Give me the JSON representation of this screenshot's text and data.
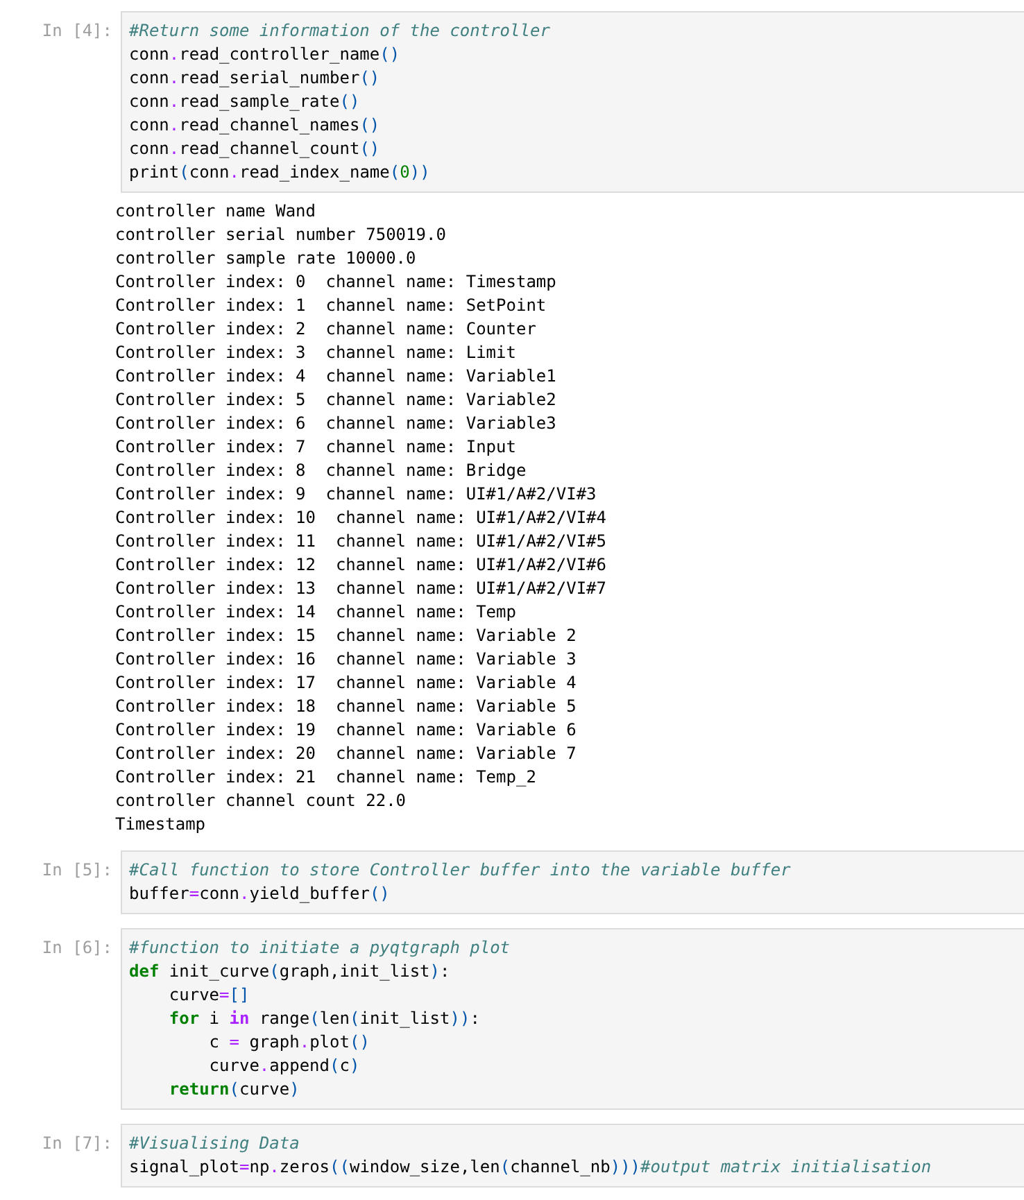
{
  "cells": [
    {
      "prompt": "In [4]:",
      "code": [
        [
          {
            "kind": "comment",
            "text": "#Return some information of the controller"
          }
        ],
        [
          {
            "kind": "name",
            "text": "conn"
          },
          {
            "kind": "op",
            "text": "."
          },
          {
            "kind": "name",
            "text": "read_controller_name"
          },
          {
            "kind": "paren",
            "text": "()"
          }
        ],
        [
          {
            "kind": "name",
            "text": "conn"
          },
          {
            "kind": "op",
            "text": "."
          },
          {
            "kind": "name",
            "text": "read_serial_number"
          },
          {
            "kind": "paren",
            "text": "()"
          }
        ],
        [
          {
            "kind": "name",
            "text": "conn"
          },
          {
            "kind": "op",
            "text": "."
          },
          {
            "kind": "name",
            "text": "read_sample_rate"
          },
          {
            "kind": "paren",
            "text": "()"
          }
        ],
        [
          {
            "kind": "name",
            "text": "conn"
          },
          {
            "kind": "op",
            "text": "."
          },
          {
            "kind": "name",
            "text": "read_channel_names"
          },
          {
            "kind": "paren",
            "text": "()"
          }
        ],
        [
          {
            "kind": "name",
            "text": "conn"
          },
          {
            "kind": "op",
            "text": "."
          },
          {
            "kind": "name",
            "text": "read_channel_count"
          },
          {
            "kind": "paren",
            "text": "()"
          }
        ],
        [
          {
            "kind": "name",
            "text": "print"
          },
          {
            "kind": "paren",
            "text": "("
          },
          {
            "kind": "name",
            "text": "conn"
          },
          {
            "kind": "op",
            "text": "."
          },
          {
            "kind": "name",
            "text": "read_index_name"
          },
          {
            "kind": "paren",
            "text": "("
          },
          {
            "kind": "number",
            "text": "0"
          },
          {
            "kind": "paren",
            "text": "))"
          }
        ]
      ],
      "output": [
        "controller name Wand",
        "controller serial number 750019.0",
        "controller sample rate 10000.0",
        "Controller index: 0  channel name: Timestamp",
        "Controller index: 1  channel name: SetPoint",
        "Controller index: 2  channel name: Counter",
        "Controller index: 3  channel name: Limit",
        "Controller index: 4  channel name: Variable1",
        "Controller index: 5  channel name: Variable2",
        "Controller index: 6  channel name: Variable3",
        "Controller index: 7  channel name: Input",
        "Controller index: 8  channel name: Bridge",
        "Controller index: 9  channel name: UI#1/A#2/VI#3",
        "Controller index: 10  channel name: UI#1/A#2/VI#4",
        "Controller index: 11  channel name: UI#1/A#2/VI#5",
        "Controller index: 12  channel name: UI#1/A#2/VI#6",
        "Controller index: 13  channel name: UI#1/A#2/VI#7",
        "Controller index: 14  channel name: Temp",
        "Controller index: 15  channel name: Variable 2",
        "Controller index: 16  channel name: Variable 3",
        "Controller index: 17  channel name: Variable 4",
        "Controller index: 18  channel name: Variable 5",
        "Controller index: 19  channel name: Variable 6",
        "Controller index: 20  channel name: Variable 7",
        "Controller index: 21  channel name: Temp_2",
        "controller channel count 22.0",
        "Timestamp"
      ]
    },
    {
      "prompt": "In [5]:",
      "code": [
        [
          {
            "kind": "comment",
            "text": "#Call function to store Controller buffer into the variable buffer"
          }
        ],
        [
          {
            "kind": "name",
            "text": "buffer"
          },
          {
            "kind": "op",
            "text": "="
          },
          {
            "kind": "name",
            "text": "conn"
          },
          {
            "kind": "op",
            "text": "."
          },
          {
            "kind": "name",
            "text": "yield_buffer"
          },
          {
            "kind": "paren",
            "text": "()"
          }
        ]
      ]
    },
    {
      "prompt": "In [6]:",
      "code": [
        [
          {
            "kind": "comment",
            "text": "#function to initiate a pyqtgraph plot"
          }
        ],
        [
          {
            "kind": "keyword",
            "text": "def"
          },
          {
            "kind": "name",
            "text": " init_curve"
          },
          {
            "kind": "paren",
            "text": "("
          },
          {
            "kind": "name",
            "text": "graph,init_list"
          },
          {
            "kind": "paren",
            "text": ")"
          },
          {
            "kind": "name",
            "text": ":"
          }
        ],
        [
          {
            "kind": "name",
            "text": "    curve"
          },
          {
            "kind": "op",
            "text": "="
          },
          {
            "kind": "paren",
            "text": "[]"
          }
        ],
        [
          {
            "kind": "keyword",
            "text": "    for"
          },
          {
            "kind": "name",
            "text": " i "
          },
          {
            "kind": "opword",
            "text": "in"
          },
          {
            "kind": "name",
            "text": " range"
          },
          {
            "kind": "paren",
            "text": "("
          },
          {
            "kind": "name",
            "text": "len"
          },
          {
            "kind": "paren",
            "text": "("
          },
          {
            "kind": "name",
            "text": "init_list"
          },
          {
            "kind": "paren",
            "text": "))"
          },
          {
            "kind": "name",
            "text": ":"
          }
        ],
        [
          {
            "kind": "name",
            "text": "        c "
          },
          {
            "kind": "op",
            "text": "="
          },
          {
            "kind": "name",
            "text": " graph"
          },
          {
            "kind": "op",
            "text": "."
          },
          {
            "kind": "name",
            "text": "plot"
          },
          {
            "kind": "paren",
            "text": "()"
          }
        ],
        [
          {
            "kind": "name",
            "text": "        curve"
          },
          {
            "kind": "op",
            "text": "."
          },
          {
            "kind": "name",
            "text": "append"
          },
          {
            "kind": "paren",
            "text": "("
          },
          {
            "kind": "name",
            "text": "c"
          },
          {
            "kind": "paren",
            "text": ")"
          }
        ],
        [
          {
            "kind": "keyword",
            "text": "    return"
          },
          {
            "kind": "paren",
            "text": "("
          },
          {
            "kind": "name",
            "text": "curve"
          },
          {
            "kind": "paren",
            "text": ")"
          }
        ]
      ]
    },
    {
      "prompt": "In [7]:",
      "code": [
        [
          {
            "kind": "comment",
            "text": "#Visualising Data"
          }
        ],
        [
          {
            "kind": "name",
            "text": "signal_plot"
          },
          {
            "kind": "op",
            "text": "="
          },
          {
            "kind": "name",
            "text": "np"
          },
          {
            "kind": "op",
            "text": "."
          },
          {
            "kind": "name",
            "text": "zeros"
          },
          {
            "kind": "paren",
            "text": "(("
          },
          {
            "kind": "name",
            "text": "window_size,len"
          },
          {
            "kind": "paren",
            "text": "("
          },
          {
            "kind": "name",
            "text": "channel_nb"
          },
          {
            "kind": "paren",
            "text": ")))"
          },
          {
            "kind": "comment",
            "text": "#output matrix initialisation"
          }
        ]
      ]
    }
  ]
}
